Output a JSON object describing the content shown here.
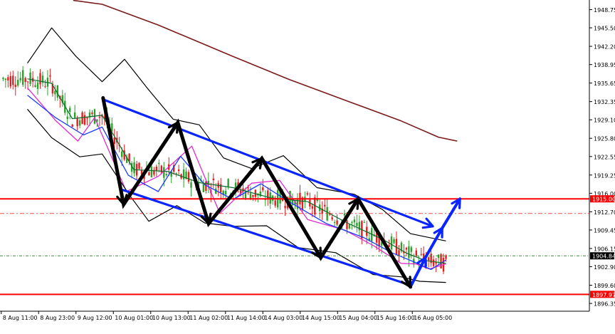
{
  "chart_data": {
    "type": "line",
    "title": "",
    "xlabel": "",
    "ylabel": "",
    "ylim": [
      1894.9,
      1950.4
    ],
    "x_ticks": [
      "8 Aug 11:00",
      "8 Aug 23:00",
      "9 Aug 12:00",
      "10 Aug 01:00",
      "10 Aug 13:00",
      "11 Aug 02:00",
      "11 Aug 14:00",
      "14 Aug 03:00",
      "14 Aug 15:00",
      "15 Aug 04:00",
      "15 Aug 16:00",
      "16 Aug 05:00"
    ],
    "y_ticks": [
      1948.75,
      1945.5,
      1942.2,
      1938.95,
      1935.65,
      1932.35,
      1929.1,
      1925.8,
      1922.55,
      1919.25,
      1916.0,
      1912.7,
      1909.45,
      1906.15,
      1902.9,
      1899.6,
      1896.35
    ],
    "price_levels": {
      "resistance": {
        "label": "1915.00",
        "value": 1915.0
      },
      "support": {
        "label": "1897.97",
        "value": 1897.97
      },
      "current": {
        "label": "1904.84",
        "value": 1904.84
      },
      "dashed_level": 1912.4
    },
    "zigzag_wave": [
      {
        "x": 4.05,
        "y": 1933.0
      },
      {
        "x": 5.15,
        "y": 1914.0
      },
      {
        "x": 8.05,
        "y": 1928.6
      },
      {
        "x": 9.7,
        "y": 1910.6
      },
      {
        "x": 12.55,
        "y": 1922.2
      },
      {
        "x": 15.7,
        "y": 1904.5
      },
      {
        "x": 17.7,
        "y": 1915.0
      },
      {
        "x": 20.5,
        "y": 1899.3
      }
    ],
    "projection_arrow": [
      {
        "x": 20.5,
        "y": 1899.3
      },
      {
        "x": 21.3,
        "y": 1904.5
      },
      {
        "x": 22.2,
        "y": 1909.8
      },
      {
        "x": 23.15,
        "y": 1915.0
      }
    ],
    "channel_upper": [
      {
        "x": 4.0,
        "y": 1932.8
      },
      {
        "x": 21.7,
        "y": 1910.1
      }
    ],
    "channel_lower": [
      {
        "x": 5.0,
        "y": 1916.7
      },
      {
        "x": 20.5,
        "y": 1899.6
      }
    ],
    "series": [
      {
        "values": [
          {
            "x": 2.45,
            "y": 1950.4
          },
          {
            "x": 4.0,
            "y": 1949.7
          },
          {
            "x": 7.0,
            "y": 1946.0
          },
          {
            "x": 11.0,
            "y": 1940.4
          },
          {
            "x": 14.0,
            "y": 1936.3
          },
          {
            "x": 17.0,
            "y": 1932.6
          },
          {
            "x": 20.0,
            "y": 1928.9
          },
          {
            "x": 22.0,
            "y": 1926.0
          },
          {
            "x": 23.0,
            "y": 1925.3
          }
        ]
      },
      {
        "values": [
          {
            "x": 0.0,
            "y": 1934.8
          },
          {
            "x": 1.5,
            "y": 1929.0
          },
          {
            "x": 2.7,
            "y": 1925.3
          },
          {
            "x": 3.6,
            "y": 1929.5
          },
          {
            "x": 5.3,
            "y": 1916.3
          },
          {
            "x": 7.0,
            "y": 1919.0
          },
          {
            "x": 8.8,
            "y": 1924.4
          },
          {
            "x": 10.3,
            "y": 1912.4
          },
          {
            "x": 12.0,
            "y": 1917.8
          },
          {
            "x": 13.5,
            "y": 1918.3
          },
          {
            "x": 15.0,
            "y": 1911.3
          },
          {
            "x": 17.0,
            "y": 1909.4
          },
          {
            "x": 18.5,
            "y": 1906.7
          },
          {
            "x": 20.0,
            "y": 1903.5
          },
          {
            "x": 20.8,
            "y": 1903.4
          },
          {
            "x": 21.5,
            "y": 1902.5
          },
          {
            "x": 22.4,
            "y": 1903.4
          }
        ]
      },
      {
        "values": [
          {
            "x": 0.0,
            "y": 1933.5
          },
          {
            "x": 1.5,
            "y": 1929.5
          },
          {
            "x": 3.0,
            "y": 1926.4
          },
          {
            "x": 4.0,
            "y": 1927.8
          },
          {
            "x": 5.4,
            "y": 1919.2
          },
          {
            "x": 7.0,
            "y": 1916.3
          },
          {
            "x": 8.2,
            "y": 1922.6
          },
          {
            "x": 9.5,
            "y": 1917.5
          },
          {
            "x": 11.0,
            "y": 1914.9
          },
          {
            "x": 12.5,
            "y": 1917.7
          },
          {
            "x": 14.0,
            "y": 1914.5
          },
          {
            "x": 16.0,
            "y": 1910.6
          },
          {
            "x": 18.0,
            "y": 1908.1
          },
          {
            "x": 19.5,
            "y": 1905.4
          },
          {
            "x": 20.8,
            "y": 1903.6
          },
          {
            "x": 21.6,
            "y": 1902.4
          },
          {
            "x": 22.4,
            "y": 1904.1
          }
        ]
      },
      {
        "values": [
          {
            "x": 0.0,
            "y": 1936.4
          },
          {
            "x": 1.3,
            "y": 1935.6
          },
          {
            "x": 2.4,
            "y": 1929.3
          },
          {
            "x": 4.0,
            "y": 1929.9
          },
          {
            "x": 5.7,
            "y": 1920.2
          },
          {
            "x": 7.5,
            "y": 1919.9
          },
          {
            "x": 9.2,
            "y": 1917.9
          },
          {
            "x": 11.0,
            "y": 1917.0
          },
          {
            "x": 13.0,
            "y": 1915.2
          },
          {
            "x": 15.0,
            "y": 1914.5
          },
          {
            "x": 17.0,
            "y": 1910.9
          },
          {
            "x": 19.0,
            "y": 1907.8
          },
          {
            "x": 20.3,
            "y": 1905.3
          },
          {
            "x": 21.3,
            "y": 1904.0
          },
          {
            "x": 22.4,
            "y": 1903.5
          }
        ]
      },
      {
        "values": [
          {
            "x": 0.0,
            "y": 1939.2
          },
          {
            "x": 1.3,
            "y": 1945.5
          },
          {
            "x": 2.6,
            "y": 1940.4
          },
          {
            "x": 4.0,
            "y": 1935.9
          },
          {
            "x": 5.2,
            "y": 1939.9
          },
          {
            "x": 6.4,
            "y": 1934.8
          },
          {
            "x": 7.8,
            "y": 1929.2
          },
          {
            "x": 9.2,
            "y": 1928.2
          },
          {
            "x": 10.5,
            "y": 1922.3
          },
          {
            "x": 12.0,
            "y": 1920.4
          },
          {
            "x": 13.7,
            "y": 1922.7
          },
          {
            "x": 15.5,
            "y": 1917.0
          },
          {
            "x": 17.5,
            "y": 1915.8
          },
          {
            "x": 19.0,
            "y": 1913.1
          },
          {
            "x": 20.5,
            "y": 1908.8
          },
          {
            "x": 21.5,
            "y": 1908.1
          },
          {
            "x": 22.4,
            "y": 1907.5
          }
        ]
      },
      {
        "values": [
          {
            "x": 0.0,
            "y": 1931.0
          },
          {
            "x": 1.3,
            "y": 1925.9
          },
          {
            "x": 2.8,
            "y": 1922.5
          },
          {
            "x": 4.0,
            "y": 1923.0
          },
          {
            "x": 5.5,
            "y": 1915.5
          },
          {
            "x": 6.5,
            "y": 1911.0
          },
          {
            "x": 8.0,
            "y": 1913.8
          },
          {
            "x": 9.5,
            "y": 1910.7
          },
          {
            "x": 11.0,
            "y": 1910.1
          },
          {
            "x": 12.8,
            "y": 1910.2
          },
          {
            "x": 14.5,
            "y": 1906.3
          },
          {
            "x": 16.5,
            "y": 1905.4
          },
          {
            "x": 18.5,
            "y": 1901.5
          },
          {
            "x": 20.0,
            "y": 1901.1
          },
          {
            "x": 21.0,
            "y": 1900.3
          },
          {
            "x": 22.4,
            "y": 1900.1
          }
        ]
      }
    ],
    "candles_count": 180,
    "colors": {
      "up_candle": "#2ca02c",
      "down_candle": "#e02020",
      "ma_slow": "#7b1a1a",
      "ma_fast_a": "#e02ad0",
      "ma_fast_b": "#1a3cff",
      "ma_mid": "#0a6b2a",
      "bands": "#000000",
      "channel": "#0a24ff",
      "zigzag": "#000000",
      "hline": "#ff0000",
      "current_label_bg": "#000000"
    }
  }
}
